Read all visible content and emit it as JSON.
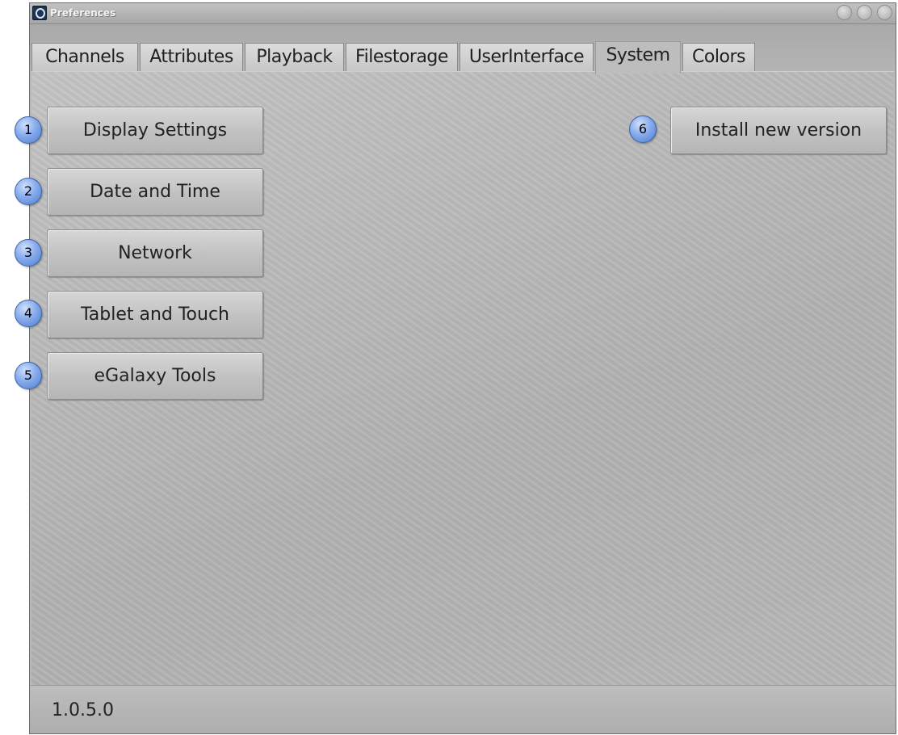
{
  "window": {
    "title": "Preferences"
  },
  "tabs": [
    {
      "label": "Channels"
    },
    {
      "label": "Attributes"
    },
    {
      "label": "Playback"
    },
    {
      "label": "Filestorage"
    },
    {
      "label": "UserInterface"
    },
    {
      "label": "System",
      "active": true
    },
    {
      "label": "Colors"
    }
  ],
  "system": {
    "buttons": [
      {
        "label": "Display Settings"
      },
      {
        "label": "Date and Time"
      },
      {
        "label": "Network"
      },
      {
        "label": "Tablet and Touch"
      },
      {
        "label": "eGalaxy Tools"
      },
      {
        "label": "Install new version"
      }
    ]
  },
  "status": {
    "version": "1.0.5.0"
  },
  "callouts": [
    "1",
    "2",
    "3",
    "4",
    "5",
    "6"
  ],
  "colors": {
    "callout_fill": "#6b96e0",
    "window_bg": "#b9b9b9"
  }
}
